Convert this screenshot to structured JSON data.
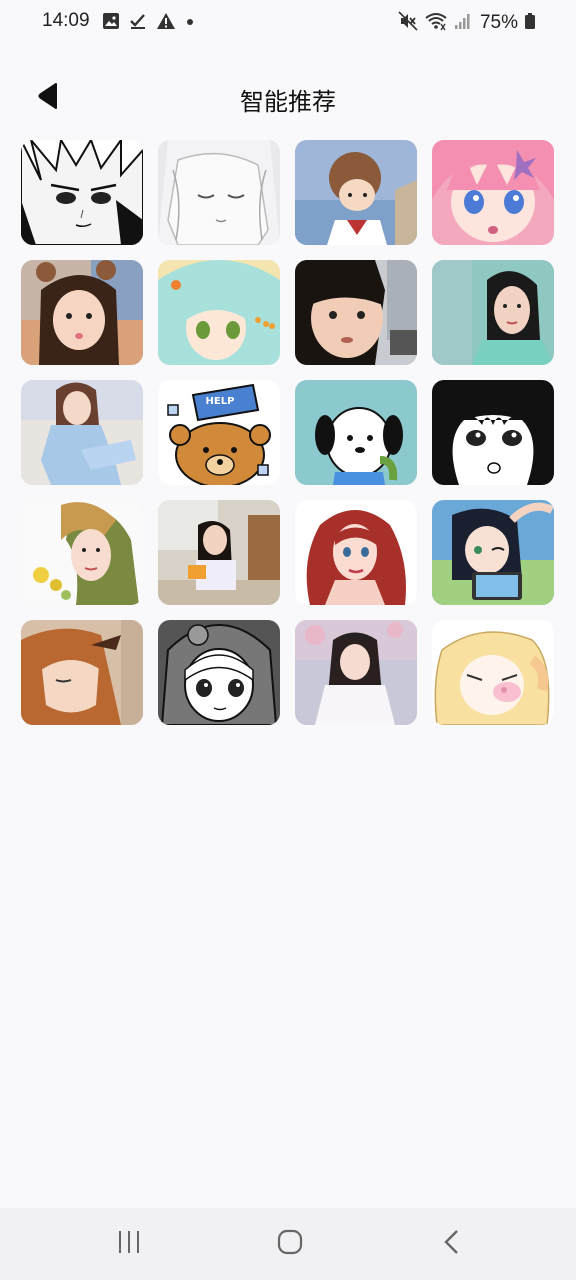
{
  "status_bar": {
    "time": "14:09",
    "left_icons": [
      "image-icon",
      "check-icon",
      "warning-icon",
      "dot-icon"
    ],
    "right_icons": [
      "mute-icon",
      "wifi-icon",
      "signal-icon"
    ],
    "battery": "75%"
  },
  "header": {
    "title": "智能推荐",
    "back_icon": "back-arrow-icon"
  },
  "grid": {
    "items": [
      {
        "name": "avatar-manga-boy-white-hair"
      },
      {
        "name": "avatar-sketch-girl-sleeping"
      },
      {
        "name": "avatar-cartoon-girl-seaside"
      },
      {
        "name": "avatar-anime-pink-hair-girl"
      },
      {
        "name": "avatar-photo-girl-bear-ears"
      },
      {
        "name": "avatar-anime-cyan-hair-girl"
      },
      {
        "name": "avatar-photo-toddler"
      },
      {
        "name": "avatar-painted-woman-black-hair"
      },
      {
        "name": "avatar-photo-girl-sitting"
      },
      {
        "name": "avatar-cartoon-bear-bucket"
      },
      {
        "name": "avatar-cartoon-dog-pochacco"
      },
      {
        "name": "avatar-manga-girl-bangs"
      },
      {
        "name": "avatar-painted-woman-flowers"
      },
      {
        "name": "avatar-photo-girl-kitchen"
      },
      {
        "name": "avatar-cartoon-red-hair-mermaid"
      },
      {
        "name": "avatar-anime-girl-phone"
      },
      {
        "name": "avatar-anime-orange-hair-girl"
      },
      {
        "name": "avatar-manga-girl-hood"
      },
      {
        "name": "avatar-photo-girl-white-dress"
      },
      {
        "name": "avatar-cartoon-blonde-girl"
      }
    ]
  },
  "nav_bar": {
    "buttons": [
      "recent-apps-icon",
      "home-icon",
      "nav-back-icon"
    ]
  }
}
